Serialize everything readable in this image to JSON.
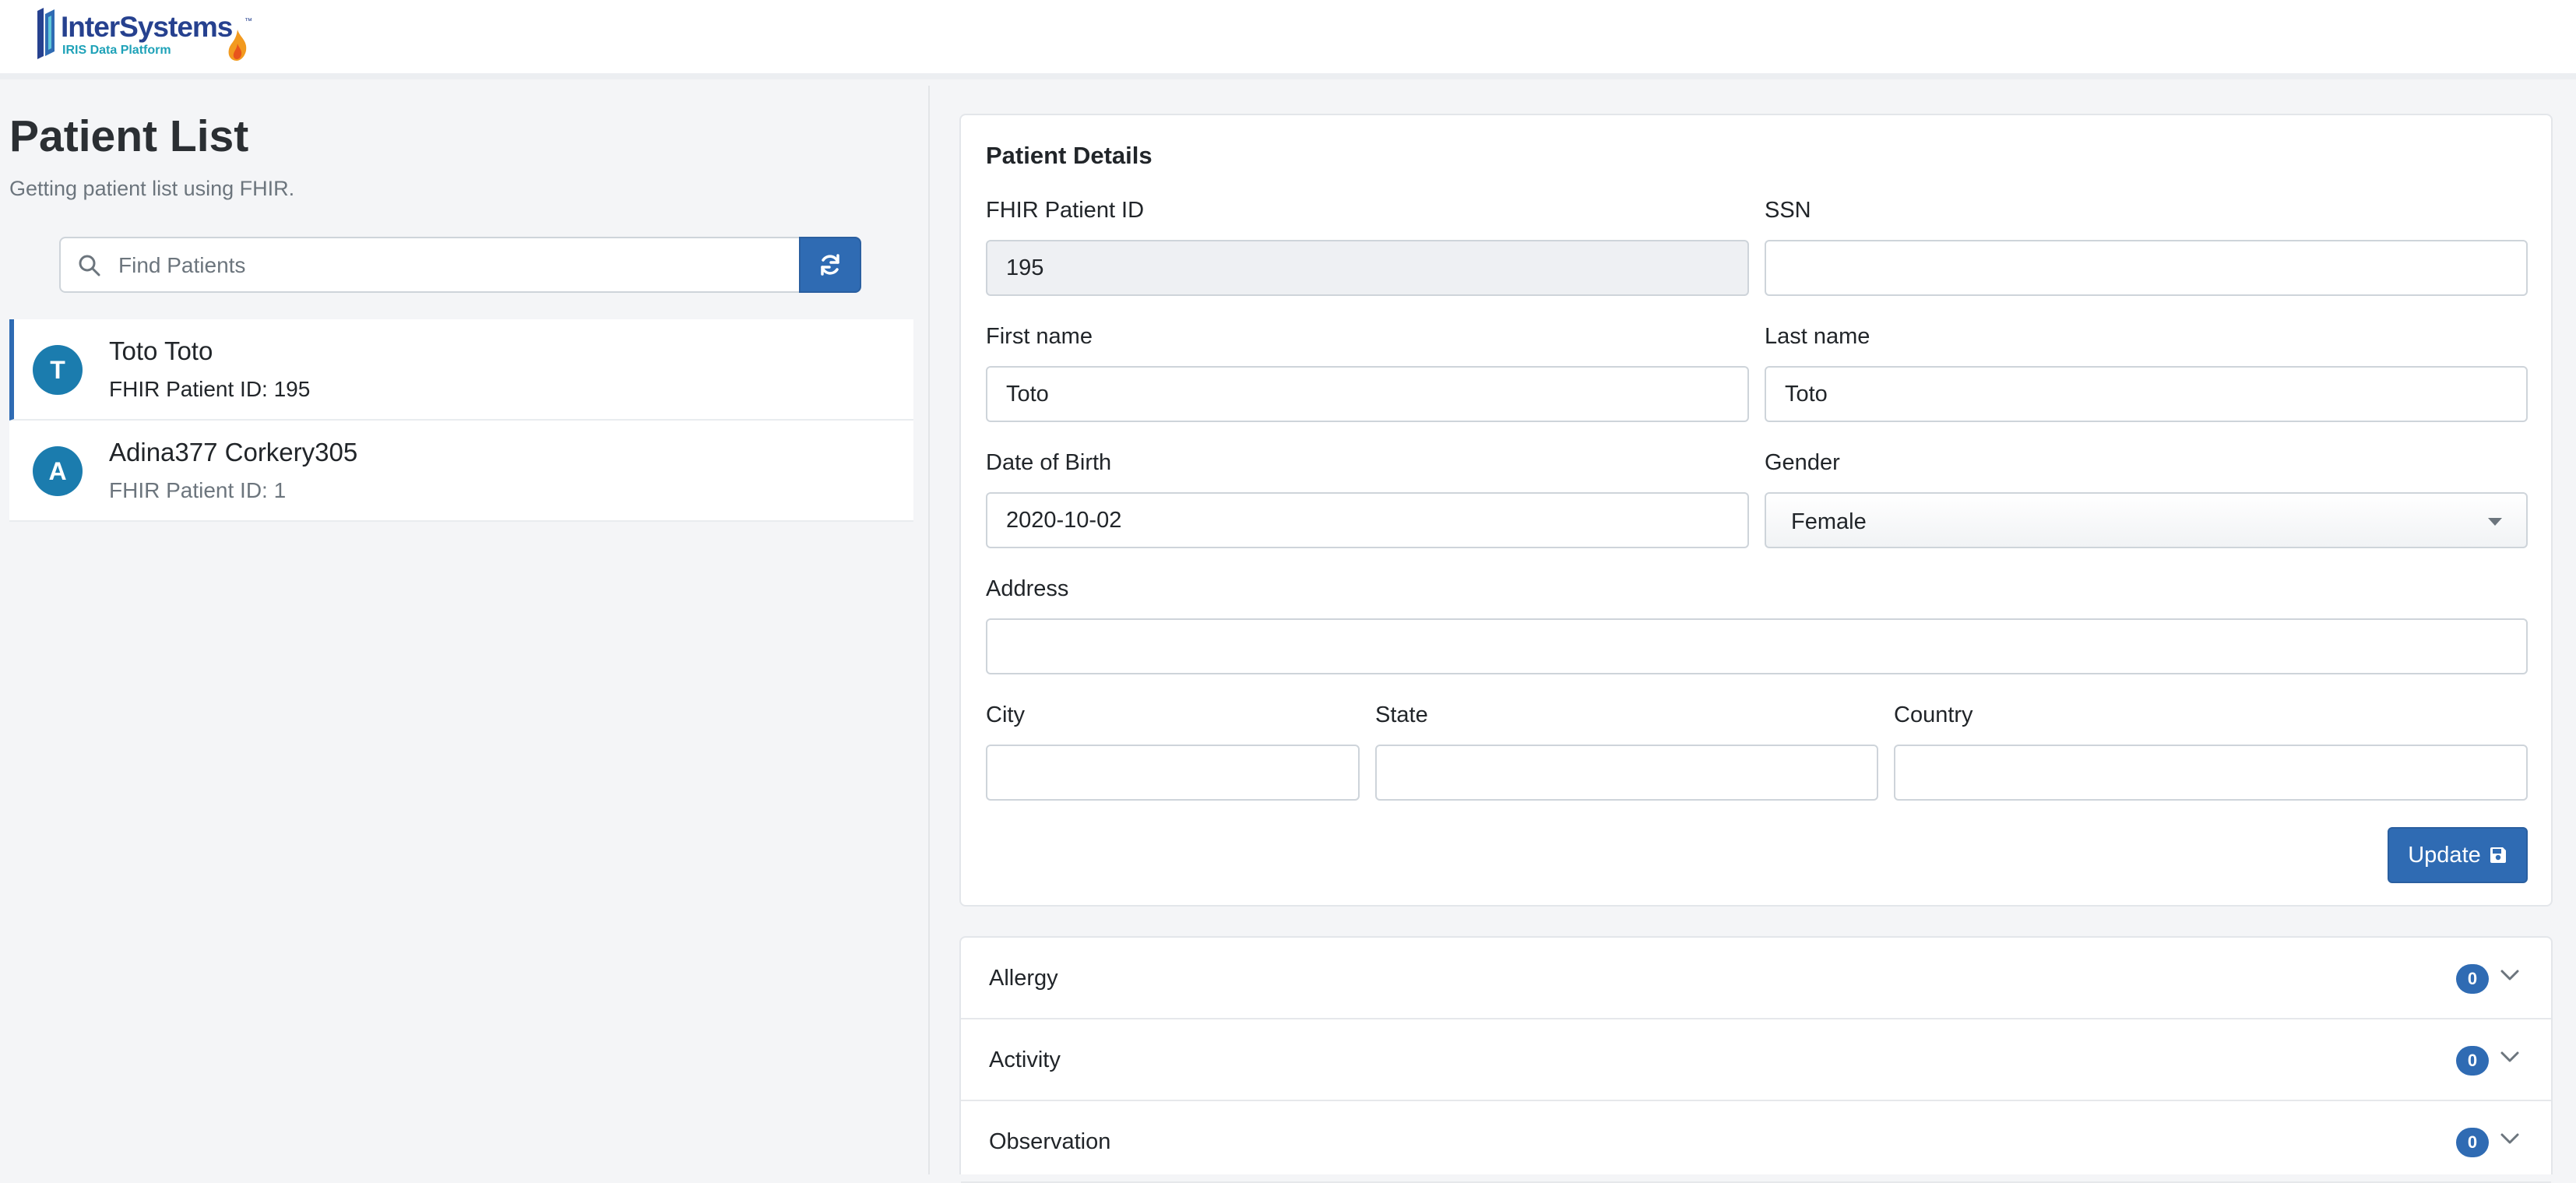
{
  "header": {
    "brand": "InterSystems",
    "trademark": "™",
    "subbrand": "IRIS Data Platform"
  },
  "patient_list": {
    "title": "Patient List",
    "subtitle": "Getting patient list using FHIR.",
    "search_placeholder": "Find Patients",
    "items": [
      {
        "initial": "T",
        "name": "Toto Toto",
        "id_text": "FHIR Patient ID: 195",
        "active": true
      },
      {
        "initial": "A",
        "name": "Adina377 Corkery305",
        "id_text": "FHIR Patient ID: 1",
        "active": false
      }
    ]
  },
  "details": {
    "title": "Patient Details",
    "fhir_id_label": "FHIR Patient ID",
    "fhir_id_value": "195",
    "ssn_label": "SSN",
    "ssn_value": "",
    "first_name_label": "First name",
    "first_name_value": "Toto",
    "last_name_label": "Last name",
    "last_name_value": "Toto",
    "dob_label": "Date of Birth",
    "dob_value": "2020-10-02",
    "gender_label": "Gender",
    "gender_value": "Female",
    "address_label": "Address",
    "address_value": "",
    "city_label": "City",
    "city_value": "",
    "state_label": "State",
    "state_value": "",
    "country_label": "Country",
    "country_value": "",
    "update_label": "Update"
  },
  "accordion": {
    "items": [
      {
        "label": "Allergy",
        "count": "0"
      },
      {
        "label": "Activity",
        "count": "0"
      },
      {
        "label": "Observation",
        "count": "0"
      }
    ]
  },
  "icons": {
    "search": "search-icon",
    "refresh": "refresh-icon",
    "save": "save-icon",
    "caret": "caret-down-icon",
    "chevron": "chevron-down-icon"
  },
  "colors": {
    "primary": "#2f6bb3",
    "avatar": "#1b7cae",
    "brand": "#26418f",
    "brand_accent": "#1fa2b8"
  }
}
